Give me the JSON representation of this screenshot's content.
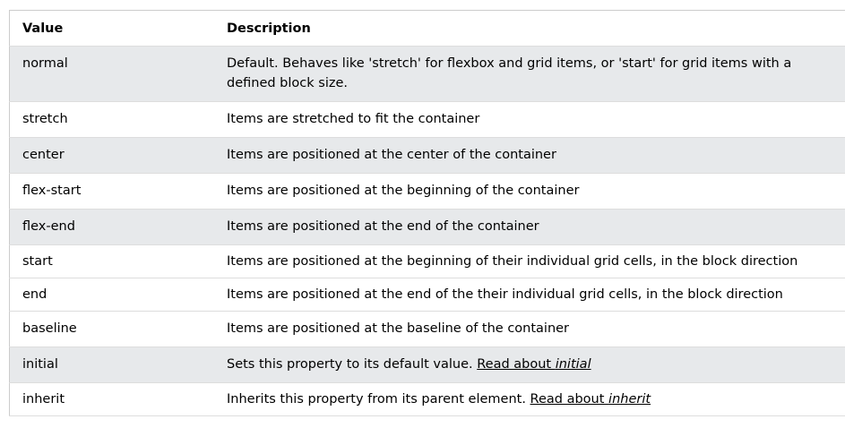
{
  "table": {
    "headers": {
      "value": "Value",
      "description": "Description"
    },
    "rows": [
      {
        "value": "normal",
        "description": "Default. Behaves like 'stretch' for flexbox and grid items, or 'start' for grid items with a defined block size."
      },
      {
        "value": "stretch",
        "description": "Items are stretched to fit the container"
      },
      {
        "value": "center",
        "description": "Items are positioned at the center of the container"
      },
      {
        "value": "flex-start",
        "description": "Items are positioned at the beginning of the container"
      },
      {
        "value": "flex-end",
        "description": "Items are positioned at the end of the container"
      },
      {
        "value": "start",
        "description": "Items are positioned at the beginning of their individual grid cells, in the block direction"
      },
      {
        "value": "end",
        "description": "Items are positioned at the end of the their individual grid cells, in the block direction"
      },
      {
        "value": "baseline",
        "description": "Items are positioned at the baseline of the container"
      },
      {
        "value": "initial",
        "description": "Sets this property to its default value.",
        "link_prefix": "Read about ",
        "link_term": "initial"
      },
      {
        "value": "inherit",
        "description": "Inherits this property from its parent element.",
        "link_prefix": "Read about ",
        "link_term": "inherit"
      }
    ]
  },
  "colors": {
    "row_shade": "#e7e9eb",
    "border": "#dddddd",
    "text": "#000000"
  }
}
